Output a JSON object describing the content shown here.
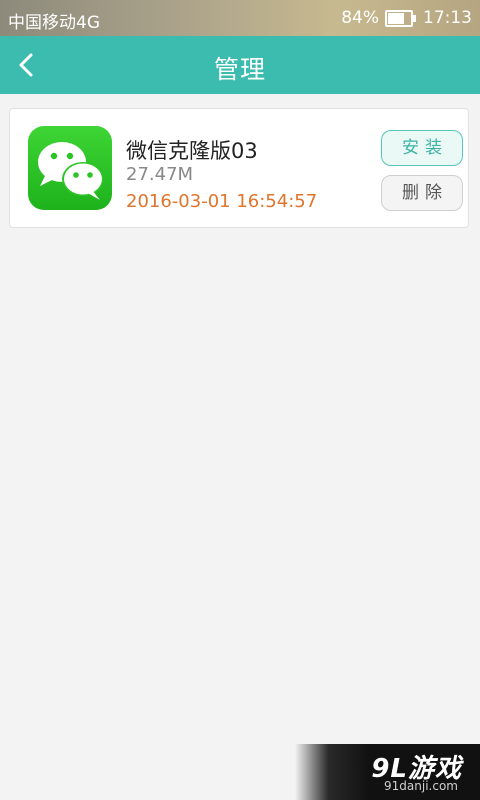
{
  "status_bar": {
    "carrier": "中国移动4G",
    "battery_percent": "84%",
    "battery_level": 0.84,
    "time": "17:13"
  },
  "header": {
    "title": "管理",
    "back_icon": "chevron-left-icon"
  },
  "apps": [
    {
      "name": "微信克隆版03",
      "size": "27.47M",
      "datetime": "2016-03-01 16:54:57",
      "icon": "wechat-icon",
      "install_label": "安装",
      "delete_label": "删除"
    }
  ],
  "colors": {
    "header": "#3cbcae",
    "install_accent": "#3cb3a5",
    "timestamp": "#e0752c",
    "app_icon_green": "#2bc425"
  },
  "watermark": {
    "brand": "9L游戏",
    "site": "91danji.com"
  }
}
